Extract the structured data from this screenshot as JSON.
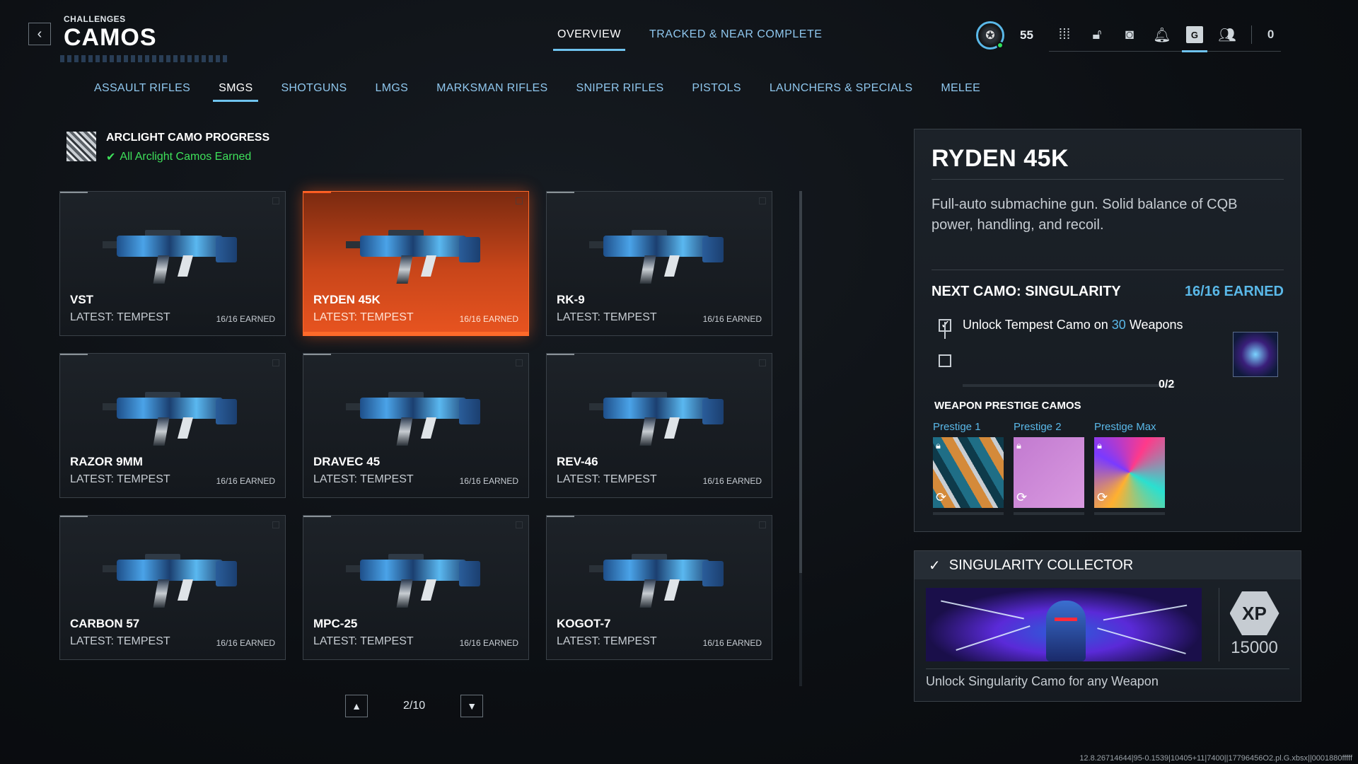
{
  "header": {
    "pre_title": "CHALLENGES",
    "title": "CAMOS",
    "back_icon": "‹"
  },
  "top_tabs": [
    {
      "label": "OVERVIEW",
      "active": true
    },
    {
      "label": "TRACKED & NEAR COMPLETE",
      "active": false
    }
  ],
  "hud": {
    "level": "55",
    "icons": [
      "grid-icon",
      "lock-icon",
      "camera-icon",
      "bell-icon",
      "guide-icon",
      "friends-icon"
    ],
    "active_icon_label": "G",
    "friends_count": "0"
  },
  "category_tabs": [
    {
      "label": "ASSAULT RIFLES",
      "active": false
    },
    {
      "label": "SMGS",
      "active": true
    },
    {
      "label": "SHOTGUNS",
      "active": false
    },
    {
      "label": "LMGS",
      "active": false
    },
    {
      "label": "MARKSMAN RIFLES",
      "active": false
    },
    {
      "label": "SNIPER RIFLES",
      "active": false
    },
    {
      "label": "PISTOLS",
      "active": false
    },
    {
      "label": "LAUNCHERS & SPECIALS",
      "active": false
    },
    {
      "label": "MELEE",
      "active": false
    }
  ],
  "arclight": {
    "title": "ARCLIGHT CAMO PROGRESS",
    "status": "All Arclight Camos Earned"
  },
  "weapons": [
    {
      "name": "VST",
      "latest": "LATEST: TEMPEST",
      "earned": "16/16 EARNED"
    },
    {
      "name": "RYDEN 45K",
      "latest": "LATEST: TEMPEST",
      "earned": "16/16 EARNED"
    },
    {
      "name": "RK-9",
      "latest": "LATEST: TEMPEST",
      "earned": "16/16 EARNED"
    },
    {
      "name": "RAZOR 9MM",
      "latest": "LATEST: TEMPEST",
      "earned": "16/16 EARNED"
    },
    {
      "name": "DRAVEC 45",
      "latest": "LATEST: TEMPEST",
      "earned": "16/16 EARNED"
    },
    {
      "name": "REV-46",
      "latest": "LATEST: TEMPEST",
      "earned": "16/16 EARNED"
    },
    {
      "name": "CARBON 57",
      "latest": "LATEST: TEMPEST",
      "earned": "16/16 EARNED"
    },
    {
      "name": "MPC-25",
      "latest": "LATEST: TEMPEST",
      "earned": "16/16 EARNED"
    },
    {
      "name": "KOGOT-7",
      "latest": "LATEST: TEMPEST",
      "earned": "16/16 EARNED"
    }
  ],
  "selected_weapon_index": 1,
  "pager": {
    "label": "2/10"
  },
  "detail": {
    "title": "RYDEN 45K",
    "description": "Full-auto submachine gun. Solid balance of CQB power, handling, and recoil.",
    "next_camo": "NEXT CAMO: SINGULARITY",
    "earned": "16/16 EARNED",
    "task_prefix": "Unlock Tempest Camo on",
    "task_count": "30",
    "task_suffix": "Weapons",
    "progress_label": "0/2",
    "progress_fraction": 0.0,
    "prestige_heading": "WEAPON PRESTIGE CAMOS",
    "prestige": [
      {
        "label": "Prestige 1"
      },
      {
        "label": "Prestige 2"
      },
      {
        "label": "Prestige Max"
      }
    ]
  },
  "collector": {
    "title": "SINGULARITY COLLECTOR",
    "xp_label": "XP",
    "xp_value": "15000",
    "description": "Unlock Singularity Camo for any Weapon"
  },
  "footer_id": "12.8.26714644|95-0.1539|10405+11|7400||17796456O2.pl.G.xbsx||0001880fffff"
}
